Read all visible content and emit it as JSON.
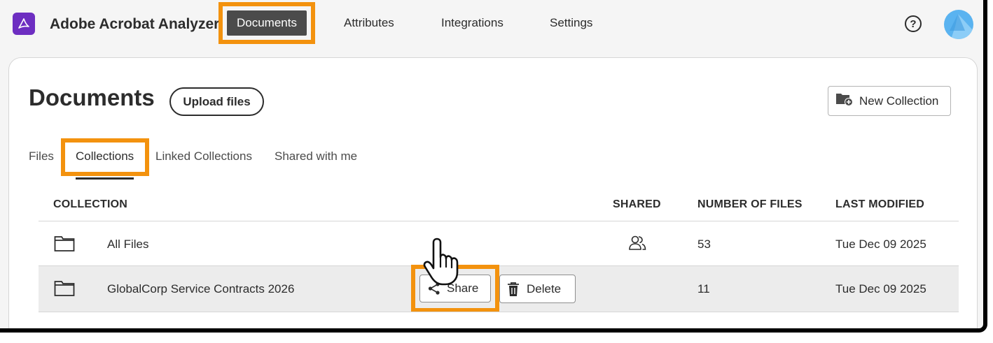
{
  "app": {
    "title": "Adobe Acrobat Analyzer",
    "logo_icon": "acrobat-logo-icon",
    "brand_color": "#6d2ec1"
  },
  "nav": {
    "items": [
      {
        "label": "Documents",
        "active": true
      },
      {
        "label": "Attributes"
      },
      {
        "label": "Integrations"
      },
      {
        "label": "Settings"
      }
    ],
    "help_icon": "help-icon",
    "help_glyph": "?"
  },
  "page": {
    "title": "Documents",
    "upload_label": "Upload files",
    "new_collection_label": "New Collection",
    "new_collection_icon": "folder-add-icon"
  },
  "tabs": [
    {
      "label": "Files"
    },
    {
      "label": "Collections",
      "active": true
    },
    {
      "label": "Linked Collections"
    },
    {
      "label": "Shared with me"
    }
  ],
  "table": {
    "columns": [
      "COLLECTION",
      "SHARED",
      "NUMBER OF FILES",
      "LAST MODIFIED"
    ],
    "rows": [
      {
        "name": "All Files",
        "shared": true,
        "shared_icon": "users-icon",
        "files": "53",
        "modified": "Tue Dec 09 2025"
      },
      {
        "name": "GlobalCorp Service Contracts 2026",
        "shared": false,
        "files": "11",
        "modified": "Tue Dec 09 2025",
        "hovered": true
      }
    ]
  },
  "row_actions": {
    "share_label": "Share",
    "share_icon": "share-icon",
    "delete_label": "Delete",
    "delete_icon": "trash-icon"
  },
  "highlight_color": "#f3920e"
}
